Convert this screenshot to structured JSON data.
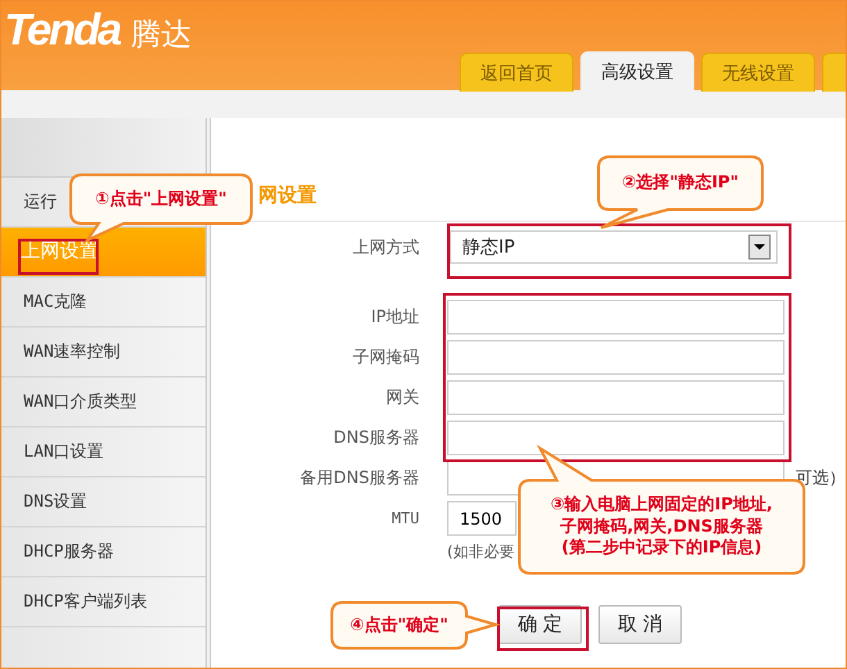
{
  "header": {
    "logo": "Tenda",
    "logo_cn": "腾达",
    "tabs": [
      {
        "label": "返回首页",
        "selected": false
      },
      {
        "label": "高级设置",
        "selected": true
      },
      {
        "label": "无线设置",
        "selected": false
      }
    ]
  },
  "sidebar": {
    "items": [
      {
        "label": "运行",
        "selected": false
      },
      {
        "label": "上网设置",
        "selected": true
      },
      {
        "label": "MAC克隆",
        "selected": false
      },
      {
        "label": "WAN速率控制",
        "selected": false
      },
      {
        "label": "WAN口介质类型",
        "selected": false
      },
      {
        "label": "LAN口设置",
        "selected": false
      },
      {
        "label": "DNS设置",
        "selected": false
      },
      {
        "label": "DHCP服务器",
        "selected": false
      },
      {
        "label": "DHCP客户端列表",
        "selected": false
      }
    ]
  },
  "content": {
    "heading": "网设置",
    "connection": {
      "label": "上网方式",
      "value": "静态IP"
    },
    "fields": [
      {
        "label": "IP地址"
      },
      {
        "label": "子网掩码"
      },
      {
        "label": "网关"
      },
      {
        "label": "DNS服务器"
      },
      {
        "label": "备用DNS服务器",
        "note": "可选）"
      }
    ],
    "mtu": {
      "label": "MTU",
      "value": "1500",
      "hint": "(如非必要"
    },
    "buttons": [
      {
        "label": "确 定"
      },
      {
        "label": "取 消"
      }
    ]
  },
  "callouts": [
    {
      "text": "①点击\"上网设置\""
    },
    {
      "text": "②选择\"静态IP\""
    },
    {
      "text": "③输入电脑上网固定的IP地址,\n子网掩码,网关,DNS服务器\n(第二步中记录下的IP信息)"
    },
    {
      "text": "④点击\"确定\""
    }
  ]
}
